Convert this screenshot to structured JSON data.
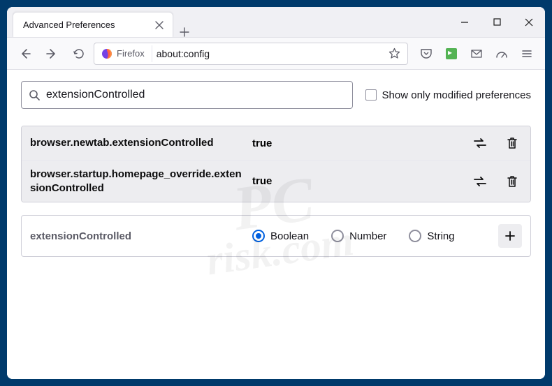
{
  "window": {
    "tab_title": "Advanced Preferences"
  },
  "navbar": {
    "identity_label": "Firefox",
    "url": "about:config"
  },
  "search": {
    "value": "extensionControlled",
    "checkbox_label": "Show only modified preferences"
  },
  "prefs": [
    {
      "name": "browser.newtab.extensionControlled",
      "value": "true",
      "modified": true
    },
    {
      "name": "browser.startup.homepage_override.extensionControlled",
      "value": "true",
      "modified": true
    }
  ],
  "add_row": {
    "name": "extensionControlled",
    "options": [
      "Boolean",
      "Number",
      "String"
    ],
    "selected": "Boolean"
  },
  "watermark": {
    "line1": "PC",
    "line2": "risk.com"
  }
}
